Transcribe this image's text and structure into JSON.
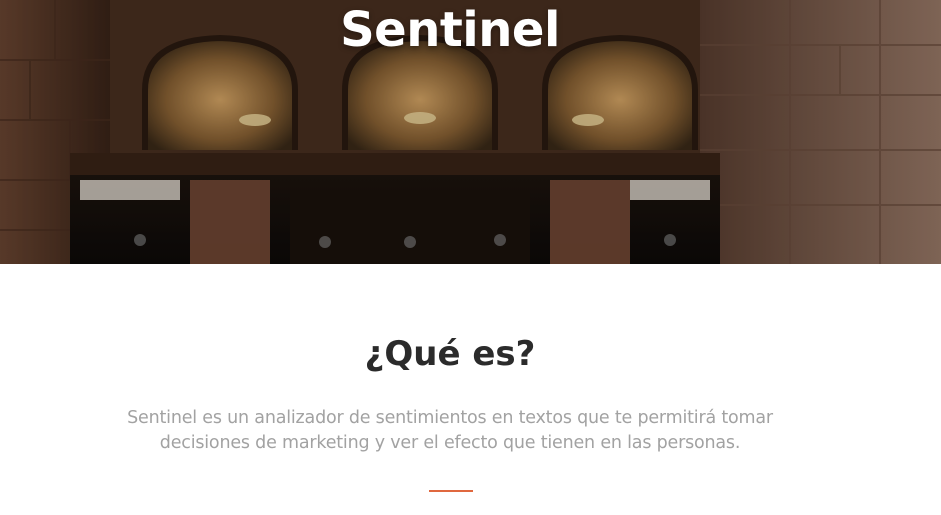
{
  "hero": {
    "title": "Sentinel",
    "image": "ornate-hall-arches-photo"
  },
  "about": {
    "title": "¿Qué es?",
    "description": "Sentinel es un analizador de sentimientos en textos que te permitirá tomar decisiones de marketing y ver el efecto que tienen en las personas."
  },
  "colors": {
    "accent": "#e0683f",
    "title_text": "#2b2b2b",
    "body_text": "#a2a2a2",
    "hero_text": "#ffffff"
  }
}
